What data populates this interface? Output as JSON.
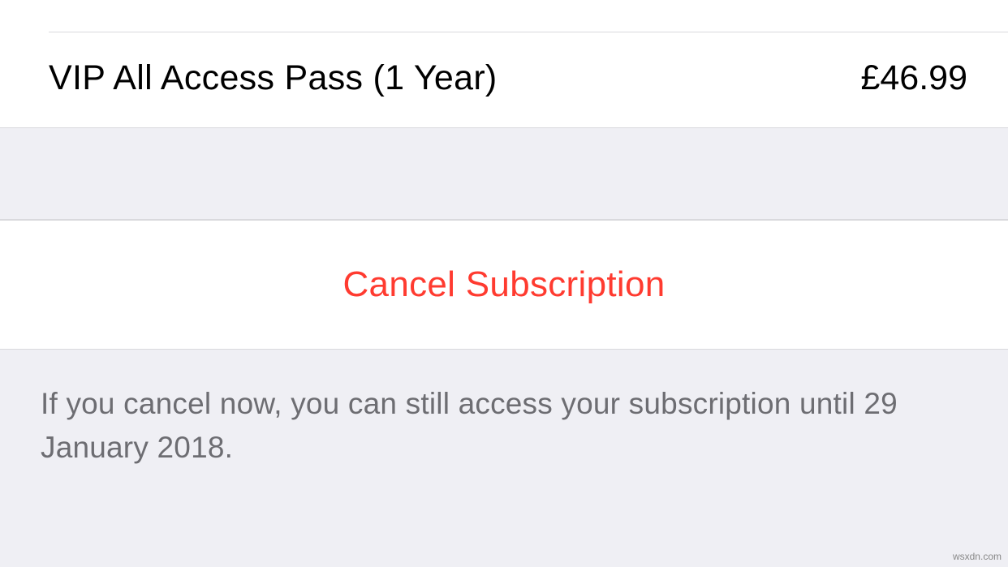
{
  "product": {
    "name": "VIP All Access Pass (1 Year)",
    "price": "£46.99"
  },
  "cancel_button": {
    "label": "Cancel Subscription"
  },
  "footer": {
    "message": "If you cancel now, you can still access your subscription until 29 January 2018."
  },
  "watermark": "wsxdn.com"
}
